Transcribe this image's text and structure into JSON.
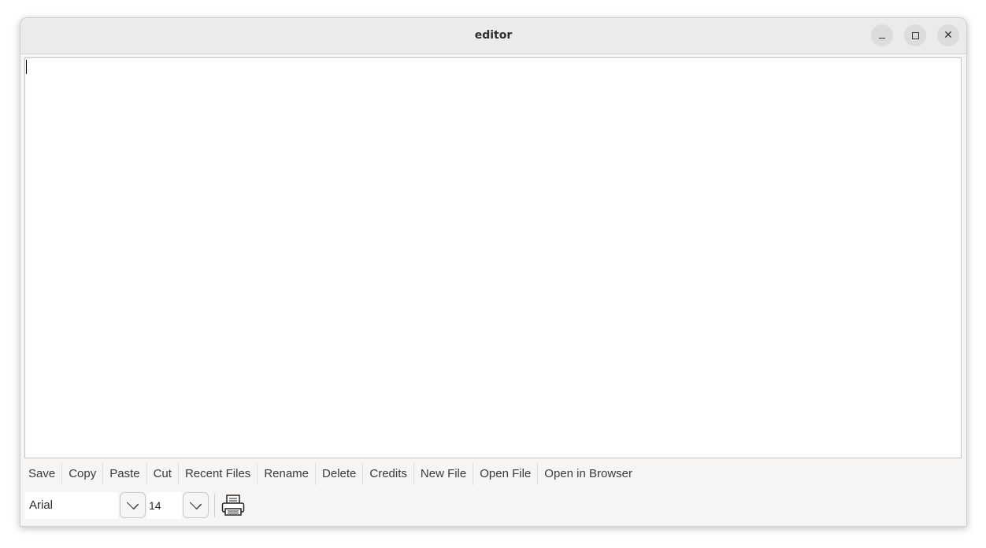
{
  "window": {
    "title": "editor"
  },
  "editor": {
    "content": ""
  },
  "menu": [
    {
      "label": "Save"
    },
    {
      "label": "Copy"
    },
    {
      "label": "Paste"
    },
    {
      "label": "Cut"
    },
    {
      "label": "Recent Files"
    },
    {
      "label": "Rename"
    },
    {
      "label": "Delete"
    },
    {
      "label": "Credits"
    },
    {
      "label": "New File"
    },
    {
      "label": "Open File"
    },
    {
      "label": "Open in Browser"
    }
  ],
  "toolbar": {
    "font_family_value": "Arial",
    "font_size_value": "14",
    "print_icon": "printer-icon"
  }
}
